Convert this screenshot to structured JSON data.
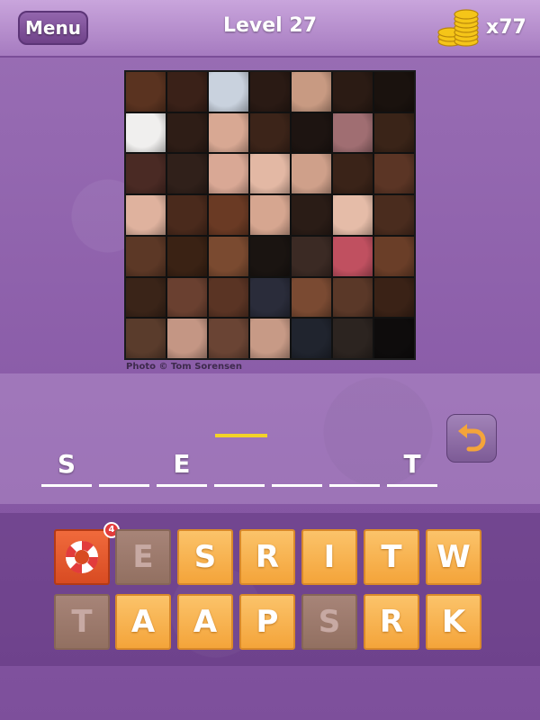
{
  "header": {
    "menu_label": "Menu",
    "level_label": "Level  27",
    "coins": "x77"
  },
  "puzzle": {
    "photo_credit": "Photo © Tom Sorensen",
    "tile_colors": [
      "#5a3320",
      "#3a2118",
      "#c9d2de",
      "#2a1a14",
      "#c89a82",
      "#2b1b14",
      "#1a120e",
      "#f0efee",
      "#2e1d16",
      "#d8a893",
      "#3c2419",
      "#1d1411",
      "#a06e72",
      "#3a2418",
      "#4a2a24",
      "#30201a",
      "#d9a895",
      "#e3b8a4",
      "#cfa08a",
      "#3a2318",
      "#5b3525",
      "#dfb29e",
      "#4a2a1c",
      "#6a3a24",
      "#d6a690",
      "#2a1c16",
      "#e5bca8",
      "#4a2c1e",
      "#5c3826",
      "#3a2214",
      "#7a4a30",
      "#1a1411",
      "#3b2a24",
      "#c05060",
      "#6a3e28",
      "#3a2418",
      "#6a4030",
      "#5a3424",
      "#2a2c3a",
      "#7a4a32",
      "#5a3828",
      "#3a2216",
      "#5a3c2c",
      "#c49684",
      "#6a4434",
      "#c79a86",
      "#20242e",
      "#2c2420",
      "#0e0c0c"
    ]
  },
  "answer": {
    "slots": [
      "S",
      "",
      "E",
      "",
      "",
      "",
      "T"
    ]
  },
  "keyboard": {
    "hint_count": "4",
    "row1": [
      "E",
      "S",
      "R",
      "I",
      "T",
      "W"
    ],
    "row2": [
      "T",
      "A",
      "A",
      "P",
      "S",
      "R",
      "K"
    ],
    "row1_used": [
      true,
      false,
      false,
      false,
      false,
      false
    ],
    "row2_used": [
      true,
      false,
      false,
      false,
      true,
      false,
      false
    ]
  },
  "icons": {
    "coins": "gold-coin-stack-icon",
    "undo": "undo-arrow-icon",
    "hint": "life-ring-icon"
  },
  "colors": {
    "key_active": "#f4a43a",
    "key_used": "#927061",
    "hint_key": "#d84b22",
    "cursor": "#f3d327"
  }
}
